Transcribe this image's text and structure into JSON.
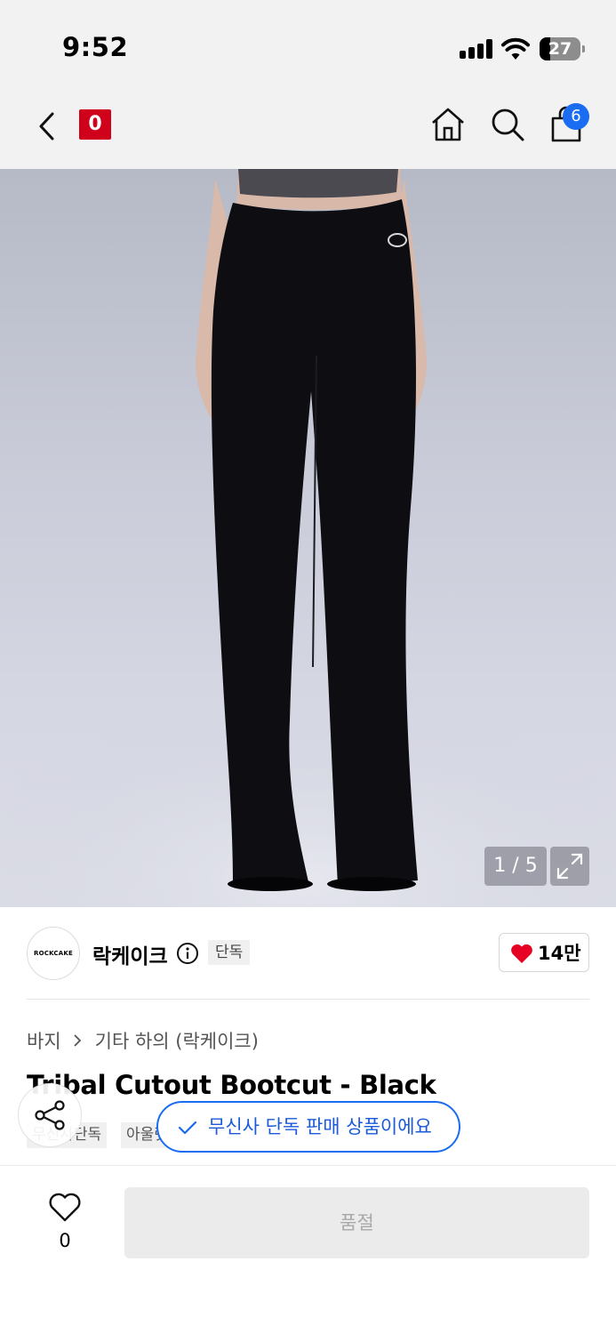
{
  "status_bar": {
    "time": "9:52",
    "battery": "27",
    "battery_level": 0.27
  },
  "nav": {
    "brand_logo_text": "0",
    "cart_count": "6"
  },
  "image": {
    "counter": "1 / 5"
  },
  "brand": {
    "avatar_text": "ROCKCAKE",
    "name": "락케이크",
    "exclusive_badge": "단독",
    "like_count": "14만"
  },
  "breadcrumb": {
    "category": "바지",
    "subcategory": "기타 하의 (락케이크)"
  },
  "product": {
    "title": "Tribal Cutout Bootcut - Black",
    "tags": [
      "무신사단독",
      "아울렛"
    ]
  },
  "toast": {
    "text": "무신사 단독 판매 상품이에요"
  },
  "bottom": {
    "wish_count": "0",
    "soldout_label": "품절"
  },
  "colors": {
    "accent_blue": "#1a6cf0",
    "brand_red": "#d0021b",
    "heart_red": "#e60023"
  }
}
